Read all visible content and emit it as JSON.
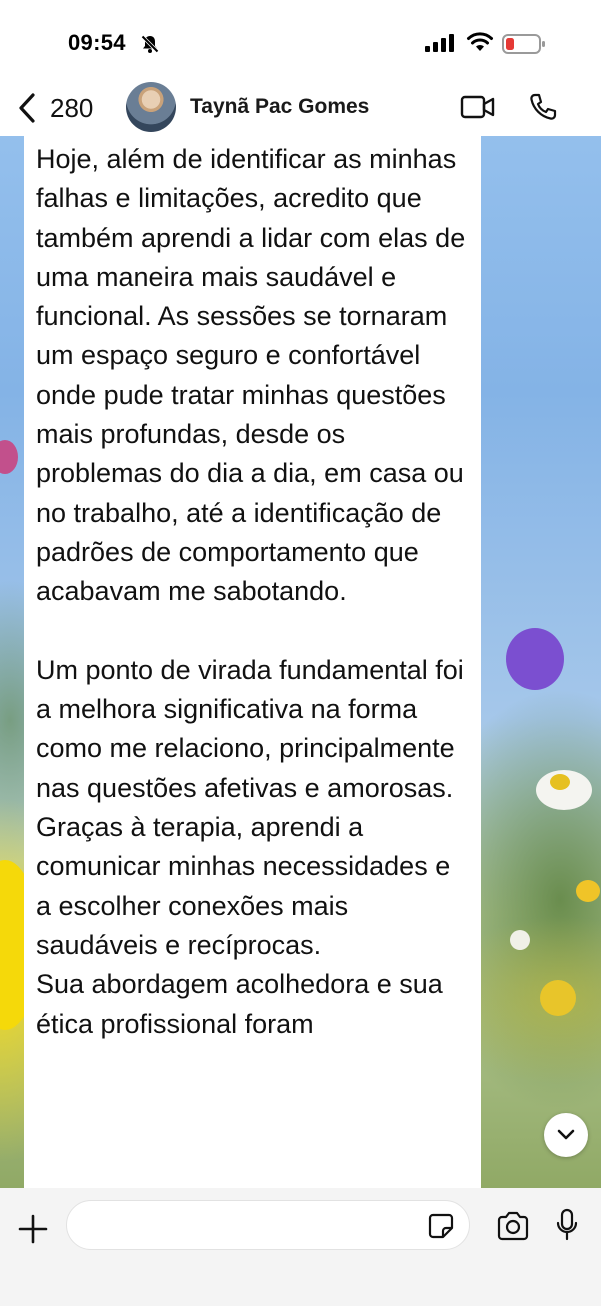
{
  "status_bar": {
    "time": "09:54",
    "mute_icon": "bell-slash-icon",
    "signal_icon": "cellular-signal-icon",
    "wifi_icon": "wifi-icon",
    "battery_icon": "battery-low-icon",
    "battery_color": "#e53935"
  },
  "header": {
    "back_icon": "chevron-left-icon",
    "unread_count": "280",
    "contact_name": "Taynã Pac Gomes",
    "video_icon": "video-camera-icon",
    "call_icon": "phone-icon"
  },
  "message": {
    "text": "Hoje, além de identificar as minhas falhas e limitações, acredito que também aprendi a lidar com elas de uma maneira mais saudável e funcional. As sessões se tornaram um espaço seguro e confortável onde pude tratar minhas questões mais profundas, desde os problemas do dia a dia, em casa ou no trabalho, até a identificação de padrões de comportamento que acabavam me sabotando.\n\nUm ponto de virada fundamental foi a melhora significativa na forma como me relaciono, principalmente nas questões afetivas e amorosas. Graças à terapia, aprendi a comunicar minhas necessidades e a escolher conexões mais saudáveis e recíprocas.\nSua abordagem acolhedora e sua ética profissional foram"
  },
  "scroll_down_icon": "chevron-down-icon",
  "composer": {
    "plus_icon": "plus-icon",
    "input_value": "",
    "sticker_icon": "sticker-icon",
    "camera_icon": "camera-icon",
    "mic_icon": "microphone-icon"
  }
}
